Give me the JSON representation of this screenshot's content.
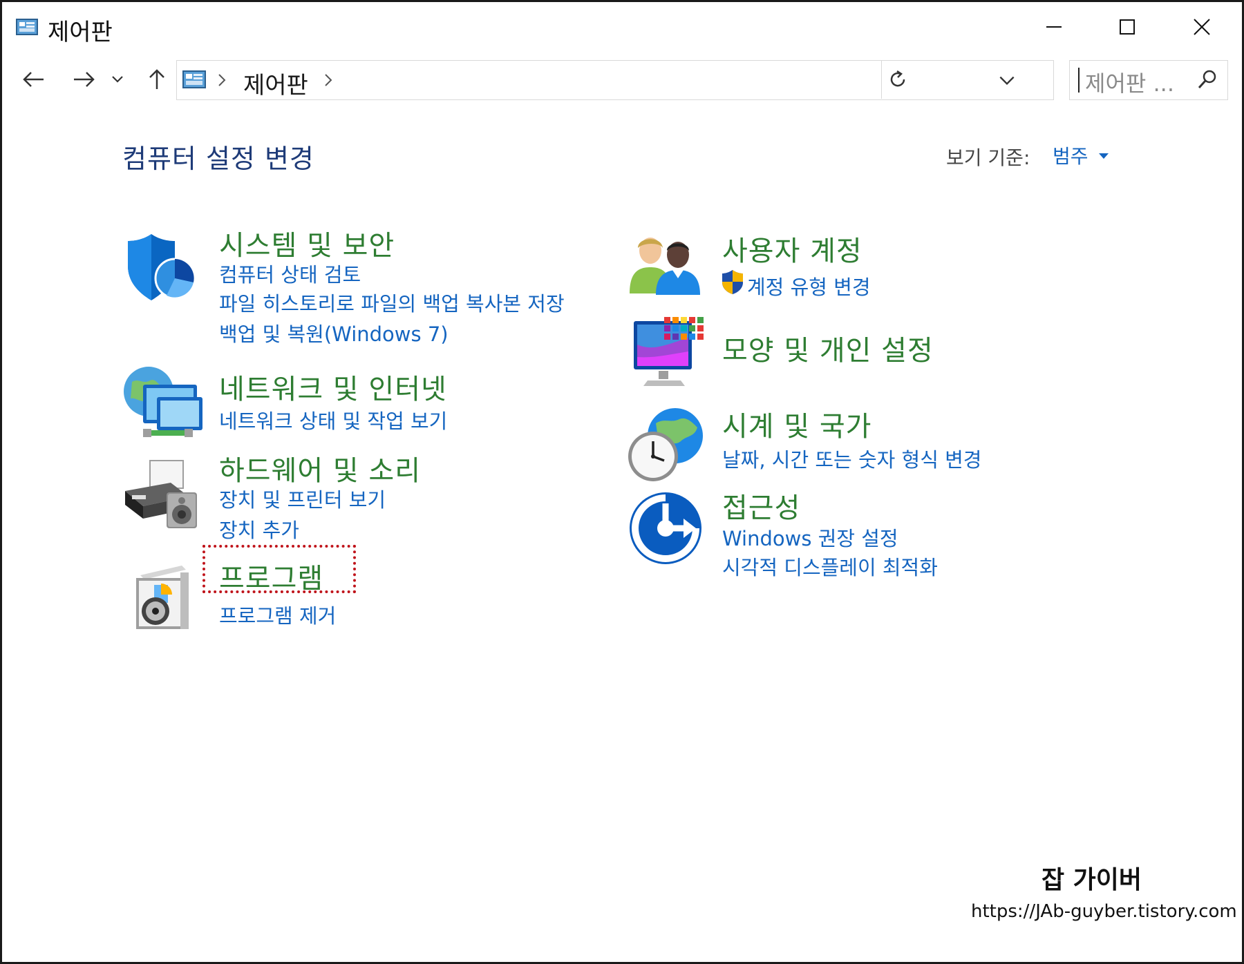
{
  "window": {
    "title": "제어판",
    "minimize_glyph": "minimize-icon",
    "maximize_glyph": "maximize-icon",
    "close_glyph": "close-icon"
  },
  "address_bar": {
    "breadcrumb": "제어판",
    "search_placeholder": "제어판 ..."
  },
  "header": {
    "title": "컴퓨터 설정 변경",
    "view_by_label": "보기 기준:",
    "view_by_value": "범주"
  },
  "categories": [
    {
      "title": "시스템 및 보안",
      "icon": "shield-icon",
      "links": [
        "컴퓨터 상태 검토",
        "파일 히스토리로 파일의 백업 복사본 저장",
        "백업 및 복원(Windows 7)"
      ]
    },
    {
      "title": "네트워크 및 인터넷",
      "icon": "network-icon",
      "links": [
        "네트워크 상태 및 작업 보기"
      ]
    },
    {
      "title": "하드웨어 및 소리",
      "icon": "printer-icon",
      "links": [
        "장치 및 프린터 보기",
        "장치 추가"
      ]
    },
    {
      "title": "프로그램",
      "icon": "programs-icon",
      "links": [
        "프로그램 제거"
      ]
    },
    {
      "title": "사용자 계정",
      "icon": "users-icon",
      "links": [
        "계정 유형 변경"
      ]
    },
    {
      "title": "모양 및 개인 설정",
      "icon": "monitor-palette-icon",
      "links": []
    },
    {
      "title": "시계 및 국가",
      "icon": "clock-globe-icon",
      "links": [
        "날짜, 시간 또는 숫자 형식 변경"
      ]
    },
    {
      "title": "접근성",
      "icon": "accessibility-icon",
      "links": [
        "Windows 권장 설정",
        "시각적 디스플레이 최적화"
      ]
    }
  ],
  "watermark": {
    "title": "잡 가이버",
    "url": "https://JAb-guyber.tistory.com"
  },
  "colors": {
    "category_title": "#2e7d32",
    "link": "#1565c0",
    "page_title": "#1e3b78",
    "highlight": "#c0141b"
  }
}
